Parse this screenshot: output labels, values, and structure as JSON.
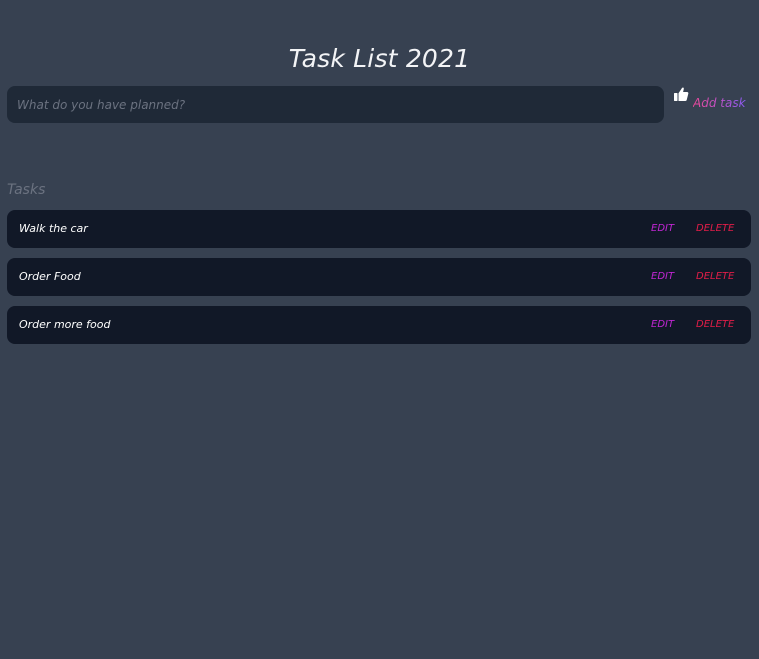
{
  "header": {
    "title": "Task List 2021"
  },
  "new_task": {
    "placeholder": "What do you have planned?",
    "value": "",
    "submit_label": "Add task",
    "icon": "thumbs-up-icon"
  },
  "tasks_section": {
    "heading": "Tasks",
    "edit_label": "EDIT",
    "delete_label": "DELETE",
    "items": [
      {
        "text": "Walk the car"
      },
      {
        "text": "Order Food"
      },
      {
        "text": "Order more food"
      }
    ]
  },
  "colors": {
    "background": "#374151",
    "input_background": "#1f2937",
    "row_background": "#111827",
    "edit": "#c026d3",
    "delete": "#e11d48",
    "heading_muted": "#6b7280"
  }
}
